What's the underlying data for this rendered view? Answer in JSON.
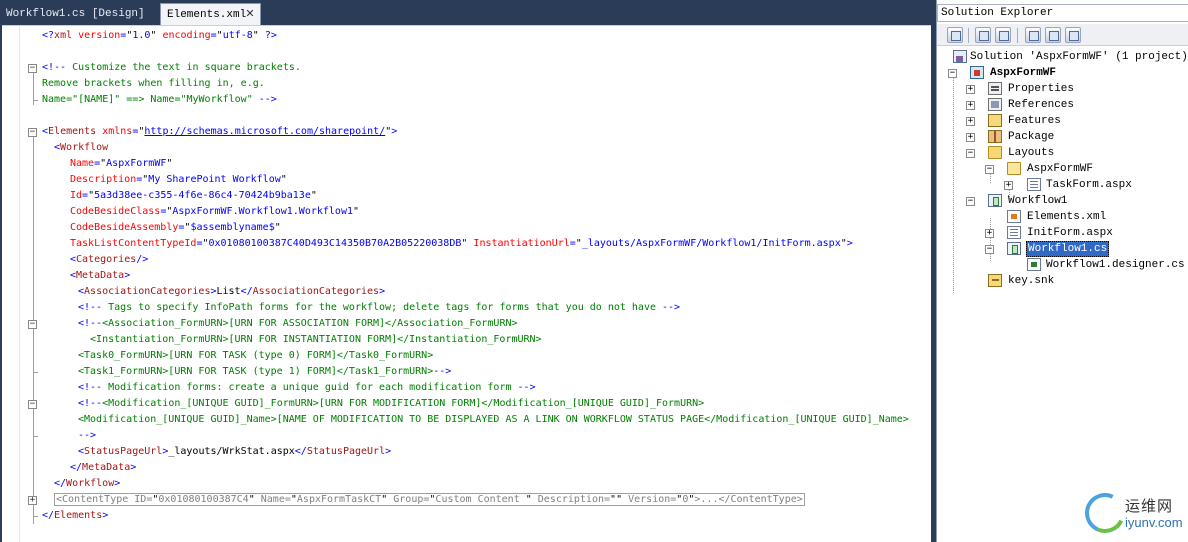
{
  "tabs": {
    "design_tab": "Workflow1.cs [Design]",
    "xml_tab": "Elements.xml",
    "close_glyph": "✕"
  },
  "code_lines": [
    {
      "indent": 0,
      "tokens": [
        {
          "t": "b",
          "s": "<?"
        },
        {
          "t": "t",
          "s": "xml"
        },
        {
          "t": "a",
          "s": " version"
        },
        {
          "t": "b",
          "s": "="
        },
        {
          "t": "x",
          "s": "\""
        },
        {
          "t": "b",
          "s": "1.0"
        },
        {
          "t": "x",
          "s": "\""
        },
        {
          "t": "a",
          "s": " encoding"
        },
        {
          "t": "b",
          "s": "="
        },
        {
          "t": "x",
          "s": "\""
        },
        {
          "t": "b",
          "s": "utf-8"
        },
        {
          "t": "x",
          "s": "\""
        },
        {
          "t": "b",
          "s": " ?>"
        }
      ]
    },
    {
      "indent": 0,
      "tokens": []
    },
    {
      "indent": 0,
      "tokens": [
        {
          "t": "b",
          "s": "<!--"
        },
        {
          "t": "c",
          "s": " Customize the text in square brackets."
        }
      ]
    },
    {
      "indent": 0,
      "tokens": [
        {
          "t": "c",
          "s": "Remove brackets when filling in, e.g."
        }
      ]
    },
    {
      "indent": 0,
      "tokens": [
        {
          "t": "c",
          "s": "Name=\"[NAME]\" ==> Name=\"MyWorkflow\" "
        },
        {
          "t": "b",
          "s": "-->"
        }
      ]
    },
    {
      "indent": 0,
      "tokens": []
    },
    {
      "indent": 0,
      "tokens": [
        {
          "t": "b",
          "s": "<"
        },
        {
          "t": "t",
          "s": "Elements"
        },
        {
          "t": "a",
          "s": " xmlns"
        },
        {
          "t": "b",
          "s": "="
        },
        {
          "t": "x",
          "s": "\""
        },
        {
          "t": "link",
          "s": "http://schemas.microsoft.com/sharepoint/"
        },
        {
          "t": "x",
          "s": "\""
        },
        {
          "t": "b",
          "s": ">"
        }
      ]
    },
    {
      "indent": 1,
      "tokens": [
        {
          "t": "b",
          "s": "<"
        },
        {
          "t": "t",
          "s": "Workflow"
        }
      ]
    },
    {
      "indent": 2,
      "tokens": [
        {
          "t": "a",
          "s": "Name"
        },
        {
          "t": "b",
          "s": "="
        },
        {
          "t": "x",
          "s": "\""
        },
        {
          "t": "b",
          "s": "AspxFormWF"
        },
        {
          "t": "x",
          "s": "\""
        }
      ]
    },
    {
      "indent": 2,
      "tokens": [
        {
          "t": "a",
          "s": "Description"
        },
        {
          "t": "b",
          "s": "="
        },
        {
          "t": "x",
          "s": "\""
        },
        {
          "t": "b",
          "s": "My SharePoint Workflow"
        },
        {
          "t": "x",
          "s": "\""
        }
      ]
    },
    {
      "indent": 2,
      "tokens": [
        {
          "t": "a",
          "s": "Id"
        },
        {
          "t": "b",
          "s": "="
        },
        {
          "t": "x",
          "s": "\""
        },
        {
          "t": "b",
          "s": "5a3d38ee-c355-4f6e-86c4-70424b9ba13e"
        },
        {
          "t": "x",
          "s": "\""
        }
      ]
    },
    {
      "indent": 2,
      "tokens": [
        {
          "t": "a",
          "s": "CodeBesideClass"
        },
        {
          "t": "b",
          "s": "="
        },
        {
          "t": "x",
          "s": "\""
        },
        {
          "t": "b",
          "s": "AspxFormWF.Workflow1.Workflow1"
        },
        {
          "t": "x",
          "s": "\""
        }
      ]
    },
    {
      "indent": 2,
      "tokens": [
        {
          "t": "a",
          "s": "CodeBesideAssembly"
        },
        {
          "t": "b",
          "s": "="
        },
        {
          "t": "x",
          "s": "\""
        },
        {
          "t": "b",
          "s": "$assemblyname$"
        },
        {
          "t": "x",
          "s": "\""
        }
      ]
    },
    {
      "indent": 2,
      "tokens": [
        {
          "t": "a",
          "s": "TaskListContentTypeId"
        },
        {
          "t": "b",
          "s": "="
        },
        {
          "t": "x",
          "s": "\""
        },
        {
          "t": "b",
          "s": "0x01080100387C40D493C14350B70A2B05220038DB"
        },
        {
          "t": "x",
          "s": "\""
        },
        {
          "t": "a",
          "s": " InstantiationUrl"
        },
        {
          "t": "b",
          "s": "="
        },
        {
          "t": "x",
          "s": "\""
        },
        {
          "t": "b",
          "s": "_layouts/AspxFormWF/Workflow1/InitForm.aspx"
        },
        {
          "t": "x",
          "s": "\""
        },
        {
          "t": "b",
          "s": ">"
        }
      ]
    },
    {
      "indent": 2,
      "tokens": [
        {
          "t": "b",
          "s": "<"
        },
        {
          "t": "t",
          "s": "Categories"
        },
        {
          "t": "b",
          "s": "/>"
        }
      ]
    },
    {
      "indent": 2,
      "tokens": [
        {
          "t": "b",
          "s": "<"
        },
        {
          "t": "t",
          "s": "MetaData"
        },
        {
          "t": "b",
          "s": ">"
        }
      ]
    },
    {
      "indent": 3,
      "tokens": [
        {
          "t": "b",
          "s": "<"
        },
        {
          "t": "t",
          "s": "AssociationCategories"
        },
        {
          "t": "b",
          "s": ">"
        },
        {
          "t": "x",
          "s": "List"
        },
        {
          "t": "b",
          "s": "</"
        },
        {
          "t": "t",
          "s": "AssociationCategories"
        },
        {
          "t": "b",
          "s": ">"
        }
      ]
    },
    {
      "indent": 3,
      "tokens": [
        {
          "t": "b",
          "s": "<!--"
        },
        {
          "t": "c",
          "s": " Tags to specify InfoPath forms for the workflow; delete tags for forms that you do not have "
        },
        {
          "t": "b",
          "s": "-->"
        }
      ]
    },
    {
      "indent": 3,
      "tokens": [
        {
          "t": "b",
          "s": "<!--"
        },
        {
          "t": "c",
          "s": "<Association_FormURN>[URN FOR ASSOCIATION FORM]</Association_FormURN>"
        }
      ]
    },
    {
      "indent": 3,
      "tokens": [
        {
          "t": "c",
          "s": "  <Instantiation_FormURN>[URN FOR INSTANTIATION FORM]</Instantiation_FormURN>"
        }
      ]
    },
    {
      "indent": 3,
      "tokens": [
        {
          "t": "c",
          "s": "<Task0_FormURN>[URN FOR TASK (type 0) FORM]</Task0_FormURN>"
        }
      ]
    },
    {
      "indent": 3,
      "tokens": [
        {
          "t": "c",
          "s": "<Task1_FormURN>[URN FOR TASK (type 1) FORM]</Task1_FormURN>"
        },
        {
          "t": "b",
          "s": "-->"
        }
      ]
    },
    {
      "indent": 3,
      "tokens": [
        {
          "t": "b",
          "s": "<!--"
        },
        {
          "t": "c",
          "s": " Modification forms: create a unique guid for each modification form "
        },
        {
          "t": "b",
          "s": "-->"
        }
      ]
    },
    {
      "indent": 3,
      "tokens": [
        {
          "t": "b",
          "s": "<!--"
        },
        {
          "t": "c",
          "s": "<Modification_[UNIQUE GUID]_FormURN>[URN FOR MODIFICATION FORM]</Modification_[UNIQUE GUID]_FormURN>"
        }
      ]
    },
    {
      "indent": 3,
      "tokens": [
        {
          "t": "c",
          "s": "<Modification_[UNIQUE GUID]_Name>[NAME OF MODIFICATION TO BE DISPLAYED AS A LINK ON WORKFLOW STATUS PAGE</Modification_[UNIQUE GUID]_Name>"
        }
      ]
    },
    {
      "indent": 3,
      "tokens": [
        {
          "t": "b",
          "s": "-->"
        }
      ]
    },
    {
      "indent": 3,
      "tokens": [
        {
          "t": "b",
          "s": "<"
        },
        {
          "t": "t",
          "s": "StatusPageUrl"
        },
        {
          "t": "b",
          "s": ">"
        },
        {
          "t": "x",
          "s": "_layouts/WrkStat.aspx"
        },
        {
          "t": "b",
          "s": "</"
        },
        {
          "t": "t",
          "s": "StatusPageUrl"
        },
        {
          "t": "b",
          "s": ">"
        }
      ]
    },
    {
      "indent": 2,
      "tokens": [
        {
          "t": "b",
          "s": "</"
        },
        {
          "t": "t",
          "s": "MetaData"
        },
        {
          "t": "b",
          "s": ">"
        }
      ]
    },
    {
      "indent": 1,
      "tokens": [
        {
          "t": "b",
          "s": "</"
        },
        {
          "t": "t",
          "s": "Workflow"
        },
        {
          "t": "b",
          "s": ">"
        }
      ]
    },
    {
      "indent": 1,
      "collapsed": true,
      "tokens": [
        {
          "t": "b",
          "s": "<"
        },
        {
          "t": "t",
          "s": "ContentType"
        },
        {
          "t": "a",
          "s": " ID"
        },
        {
          "t": "b",
          "s": "="
        },
        {
          "t": "x",
          "s": "\""
        },
        {
          "t": "b",
          "s": "0x01080100387C4"
        },
        {
          "t": "x",
          "s": "\""
        },
        {
          "t": "a",
          "s": " Name"
        },
        {
          "t": "b",
          "s": "="
        },
        {
          "t": "x",
          "s": "\""
        },
        {
          "t": "b",
          "s": "AspxFormTaskCT"
        },
        {
          "t": "x",
          "s": "\""
        },
        {
          "t": "a",
          "s": " Group"
        },
        {
          "t": "b",
          "s": "="
        },
        {
          "t": "x",
          "s": "\""
        },
        {
          "t": "b",
          "s": "Custom Content "
        },
        {
          "t": "x",
          "s": "\""
        },
        {
          "t": "a",
          "s": " Description"
        },
        {
          "t": "b",
          "s": "="
        },
        {
          "t": "x",
          "s": "\"\""
        },
        {
          "t": "a",
          "s": " Version"
        },
        {
          "t": "b",
          "s": "="
        },
        {
          "t": "x",
          "s": "\""
        },
        {
          "t": "b",
          "s": "0"
        },
        {
          "t": "x",
          "s": "\""
        },
        {
          "t": "b",
          "s": ">...</"
        },
        {
          "t": "t",
          "s": "ContentType"
        },
        {
          "t": "b",
          "s": ">"
        }
      ]
    },
    {
      "indent": 0,
      "tokens": [
        {
          "t": "b",
          "s": "</"
        },
        {
          "t": "t",
          "s": "Elements"
        },
        {
          "t": "b",
          "s": ">"
        }
      ]
    }
  ],
  "outline_glyphs": {
    "collapse": "−",
    "expand": "+"
  },
  "solution_explorer": {
    "title": "Solution Explorer",
    "solution_label": "Solution 'AspxFormWF' (1 project)",
    "project_label": "AspxFormWF",
    "items": {
      "properties": "Properties",
      "references": "References",
      "features": "Features",
      "package": "Package",
      "layouts": "Layouts",
      "layouts_folder": "AspxFormWF",
      "taskform": "TaskForm.aspx",
      "workflow1": "Workflow1",
      "elements_xml": "Elements.xml",
      "initform": "InitForm.aspx",
      "workflow1_cs": "Workflow1.cs",
      "designer_cs": "Workflow1.designer.cs",
      "key_snk": "key.snk"
    }
  },
  "watermark": {
    "cn": "运维网",
    "en": "iyunv.com"
  }
}
